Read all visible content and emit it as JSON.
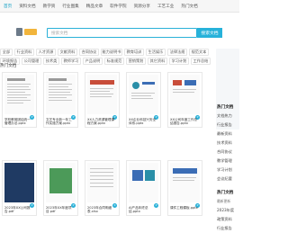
{
  "topnav": {
    "items": [
      "首页",
      "资料文档",
      "教学资",
      "行业图集",
      "精品文章",
      "软件学院",
      "资源分享",
      "工艺工业",
      "热门文档"
    ]
  },
  "search": {
    "placeholder": "搜索文档",
    "button_label": "搜索文档"
  },
  "tags": [
    [
      "全部",
      "行业资料",
      "人才资源",
      "文献资料",
      "合同协议",
      "能力说明书",
      "教育培训",
      "生活娱乐",
      "法律法规",
      "规范文本"
    ],
    [
      "环境报告",
      "公司管理",
      "技术类",
      "教师学习",
      "产品说明",
      "标准规范",
      "营销策划",
      "其它资料",
      "学习计划",
      "工作总结"
    ]
  ],
  "section_title": "热门文档",
  "cards": [
    {
      "title": "学校教育团结统一管理办法.pptx"
    },
    {
      "title": "文艺专业新一年工作实施方案.pptx"
    },
    {
      "title": "XX人力资源管理课程方案.pptx"
    },
    {
      "title": "XX企业科技兴安全体系.pptx"
    },
    {
      "title": "XX公司年度工作总结报告.pptx"
    },
    {
      "title": "2023年XX公司报告.pdf"
    },
    {
      "title": "2023年XX年度项目.pdf"
    },
    {
      "title": "2023年合同明细表.xlsx"
    },
    {
      "title": "AI产品年终总结.pptx"
    },
    {
      "title": "课件工程模板.pptx"
    }
  ],
  "sidebar": {
    "hot_title": "热门文档",
    "hot_items": [
      "文档热力",
      "行业报告",
      "最新资料",
      "技术资料",
      "合同协议",
      "教学管理",
      "学习计划",
      "会议纪要"
    ],
    "recent_title": "热门文档",
    "recent_date": "最新更新",
    "recent_items": [
      "2023年度",
      "政策资料",
      "行业报告"
    ]
  }
}
